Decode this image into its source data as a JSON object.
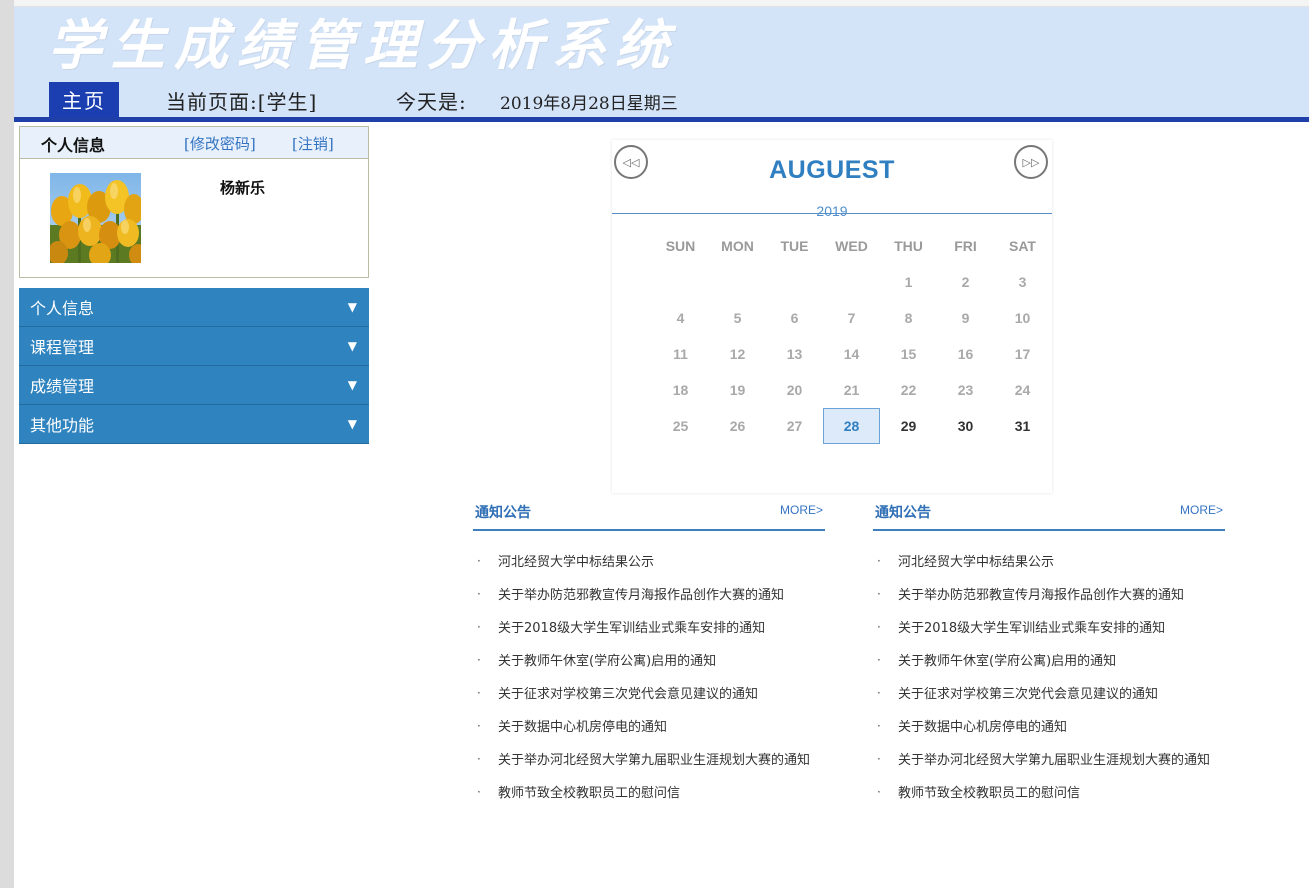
{
  "header": {
    "site_title": "学生成绩管理分析系统",
    "home_label": "主页",
    "current_page": "当前页面:[学生]",
    "today_label": "今天是:",
    "today_date": "2019年8月28日星期三"
  },
  "info": {
    "title": "个人信息",
    "change_password": "[修改密码]",
    "logout": "[注销]",
    "user_name": "杨新乐"
  },
  "menu": {
    "items": [
      {
        "label": "个人信息"
      },
      {
        "label": "课程管理"
      },
      {
        "label": "成绩管理"
      },
      {
        "label": "其他功能"
      }
    ],
    "arrow": "▼"
  },
  "calendar": {
    "month": "AUGUEST",
    "year": "2019",
    "prev_symbol": "◁◁",
    "next_symbol": "▷▷",
    "weekdays": [
      "SUN",
      "MON",
      "TUE",
      "WED",
      "THU",
      "FRI",
      "SAT"
    ],
    "weeks": [
      [
        "",
        "",
        "",
        "",
        "1",
        "2",
        "3"
      ],
      [
        "4",
        "5",
        "6",
        "7",
        "8",
        "9",
        "10"
      ],
      [
        "11",
        "12",
        "13",
        "14",
        "15",
        "16",
        "17"
      ],
      [
        "18",
        "19",
        "20",
        "21",
        "22",
        "23",
        "24"
      ],
      [
        "25",
        "26",
        "27",
        "28",
        "29",
        "30",
        "31"
      ]
    ],
    "today": "28",
    "future_days": [
      "29",
      "30",
      "31"
    ]
  },
  "notices": [
    {
      "title": "通知公告",
      "more": "MORE>",
      "items": [
        "河北经贸大学中标结果公示",
        "关于举办防范邪教宣传月海报作品创作大赛的通知",
        "关于2018级大学生军训结业式乘车安排的通知",
        "关于教师午休室(学府公寓)启用的通知",
        "关于征求对学校第三次党代会意见建议的通知",
        "关于数据中心机房停电的通知",
        "关于举办河北经贸大学第九届职业生涯规划大赛的通知",
        "教师节致全校教职员工的慰问信"
      ]
    },
    {
      "title": "通知公告",
      "more": "MORE>",
      "items": [
        "河北经贸大学中标结果公示",
        "关于举办防范邪教宣传月海报作品创作大赛的通知",
        "关于2018级大学生军训结业式乘车安排的通知",
        "关于教师午休室(学府公寓)启用的通知",
        "关于征求对学校第三次党代会意见建议的通知",
        "关于数据中心机房停电的通知",
        "关于举办河北经贸大学第九届职业生涯规划大赛的通知",
        "教师节致全校教职员工的慰问信"
      ]
    }
  ],
  "bullet": "·",
  "colors": {
    "header_bg": "#d3e3f8",
    "accent_blue": "#1e40a8",
    "menu_blue": "#2f83bf",
    "calendar_blue": "#2f7fc1"
  }
}
